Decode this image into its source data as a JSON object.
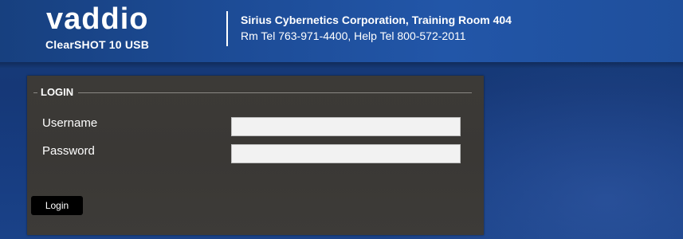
{
  "header": {
    "logo_text": "vaddio",
    "product_name": "ClearSHOT 10 USB",
    "organization": "Sirius Cybernetics Corporation, Training Room 404",
    "telephone": "Rm Tel 763-971-4400, Help Tel 800-572-2011"
  },
  "login": {
    "legend": "LOGIN",
    "username_label": "Username",
    "username_value": "",
    "password_label": "Password",
    "password_value": "",
    "button_label": "Login"
  },
  "colors": {
    "header_blue": "#1d4c97",
    "background_blue": "#163a78",
    "panel": "#3c3a37",
    "button": "#000000",
    "text": "#ffffff"
  }
}
